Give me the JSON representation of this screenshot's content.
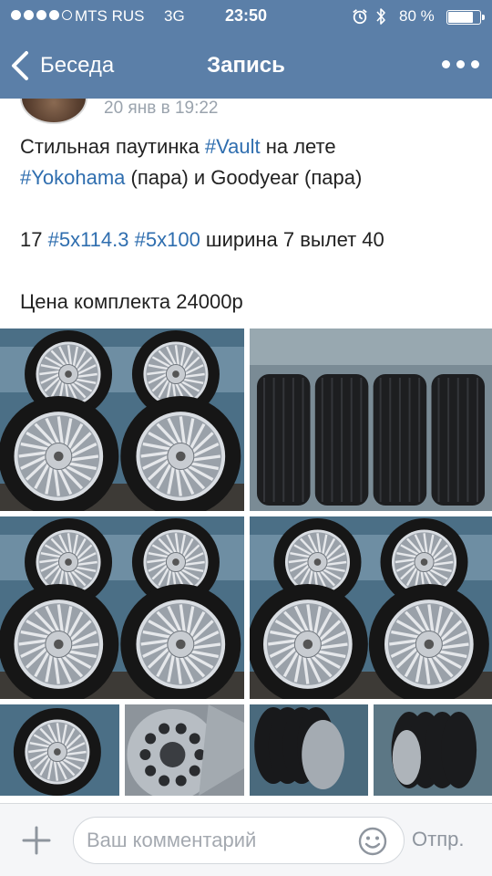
{
  "status_bar": {
    "carrier": "MTS RUS",
    "network": "3G",
    "time": "23:50",
    "battery": "80 %",
    "battery_level": 0.8,
    "signal_strength": 4,
    "icons": [
      "alarm-icon",
      "bluetooth-icon",
      "battery-icon"
    ]
  },
  "nav": {
    "back_label": "Беседа",
    "title": "Запись",
    "more_icon": "more-dots-icon"
  },
  "post": {
    "date": "20 янв в 19:22",
    "lines": [
      [
        {
          "t": "Стильная паутинка "
        },
        {
          "t": "#Vault",
          "tag": true
        },
        {
          "t": " на лете"
        }
      ],
      [
        {
          "t": "#Yokohama",
          "tag": true
        },
        {
          "t": " (пара) и Goodyear (пара)"
        }
      ],
      [],
      [
        {
          "t": "17 "
        },
        {
          "t": "#5x114.3",
          "tag": true
        },
        {
          "t": " "
        },
        {
          "t": "#5x100",
          "tag": true
        },
        {
          "t": " ширина 7 вылет 40"
        }
      ],
      [],
      [
        {
          "t": "Цена комплекта 24000р"
        }
      ]
    ],
    "photos": [
      {
        "kind": "wheels4"
      },
      {
        "kind": "tires4"
      },
      {
        "kind": "wheels4"
      },
      {
        "kind": "wheels4"
      },
      {
        "kind": "wheel1"
      },
      {
        "kind": "hub"
      },
      {
        "kind": "wheelsSide"
      },
      {
        "kind": "tiresSide"
      }
    ]
  },
  "colors": {
    "header": "#5b7fa8",
    "hashtag": "#2f6eaf",
    "date": "#9aa3ad"
  },
  "comment_bar": {
    "placeholder": "Ваш комментарий",
    "send_label": "Отпр.",
    "attach_icon": "plus-icon",
    "emoji_icon": "smile-icon"
  }
}
